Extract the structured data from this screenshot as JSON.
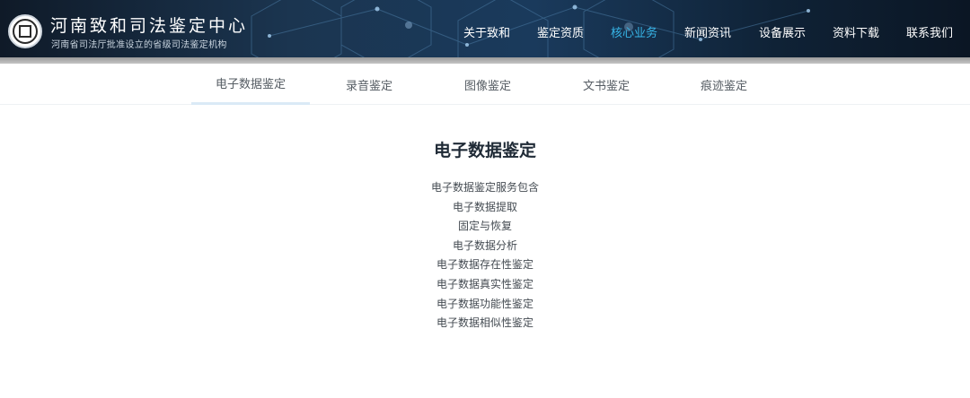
{
  "site": {
    "title": "河南致和司法鉴定中心",
    "subtitle": "河南省司法厅批准设立的省级司法鉴定机构",
    "logo_icon": "seal-logo-icon"
  },
  "nav": {
    "items": [
      {
        "label": "关于致和",
        "active": false
      },
      {
        "label": "鉴定资质",
        "active": false
      },
      {
        "label": "核心业务",
        "active": true
      },
      {
        "label": "新闻资讯",
        "active": false
      },
      {
        "label": "设备展示",
        "active": false
      },
      {
        "label": "资料下载",
        "active": false
      },
      {
        "label": "联系我们",
        "active": false
      }
    ],
    "active_color": "#37b6e8"
  },
  "tabs": {
    "items": [
      {
        "label": "电子数据鉴定",
        "active": true
      },
      {
        "label": "录音鉴定",
        "active": false
      },
      {
        "label": "图像鉴定",
        "active": false
      },
      {
        "label": "文书鉴定",
        "active": false
      },
      {
        "label": "痕迹鉴定",
        "active": false
      }
    ]
  },
  "content": {
    "title": "电子数据鉴定",
    "items": [
      "电子数据鉴定服务包含",
      "电子数据提取",
      "固定与恢复",
      "电子数据分析",
      "电子数据存在性鉴定",
      "电子数据真实性鉴定",
      "电子数据功能性鉴定",
      "电子数据相似性鉴定"
    ]
  }
}
